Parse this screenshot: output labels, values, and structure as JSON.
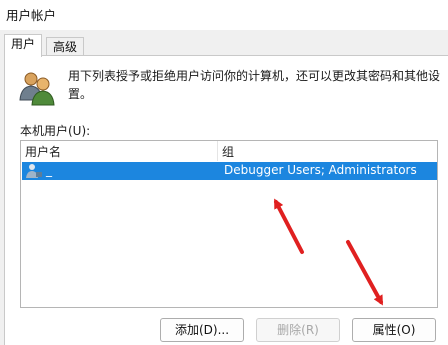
{
  "window": {
    "title": "用户帐户"
  },
  "tabs": [
    {
      "label": "用户",
      "active": true
    },
    {
      "label": "高级",
      "active": false
    }
  ],
  "intro": {
    "text": "用下列表授予或拒绝用户访问你的计算机，还可以更改其密码和其他设置。"
  },
  "users": {
    "label": "本机用户(U):",
    "columns": {
      "name": "用户名",
      "group": "组"
    },
    "rows": [
      {
        "name": "_",
        "group": "Debugger Users; Administrators",
        "selected": true
      }
    ]
  },
  "buttons": {
    "add": "添加(D)...",
    "remove": "删除(R)",
    "properties": "属性(O)"
  },
  "colors": {
    "selection": "#1c86df",
    "annotation_arrow": "#e02020"
  }
}
